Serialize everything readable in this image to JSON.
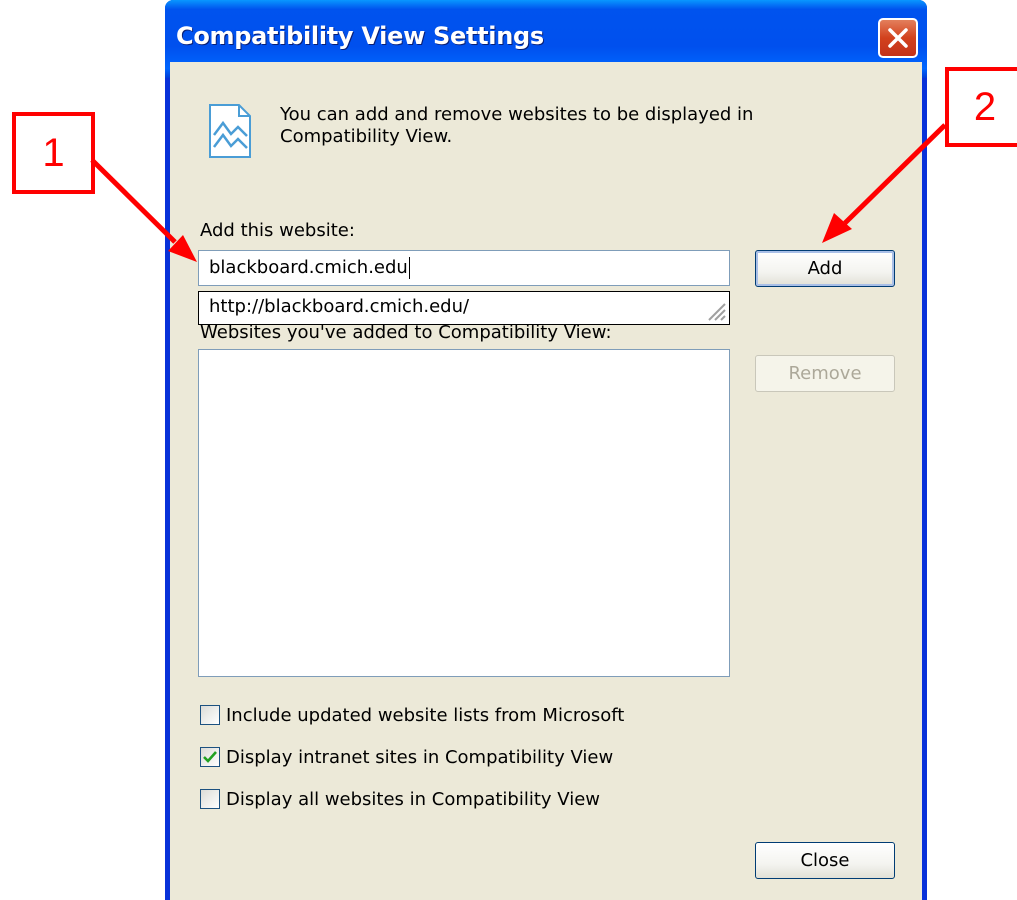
{
  "window": {
    "title": "Compatibility View Settings"
  },
  "info": {
    "text": "You can add and remove websites to be displayed in Compatibility View."
  },
  "add_site": {
    "label": "Add this website:",
    "value": "blackboard.cmich.edu",
    "suggestion": "http://blackboard.cmich.edu/"
  },
  "site_list": {
    "label": "Websites you've added to Compatibility View:",
    "items": []
  },
  "buttons": {
    "add": "Add",
    "remove": "Remove",
    "close": "Close"
  },
  "checkboxes": [
    {
      "label": "Include updated website lists from Microsoft",
      "checked": false
    },
    {
      "label": "Display intranet sites in Compatibility View",
      "checked": true
    },
    {
      "label": "Display all websites in Compatibility View",
      "checked": false
    }
  ],
  "callouts": {
    "one": "1",
    "two": "2"
  },
  "colors": {
    "callout": "#ff0000",
    "titlebar": "#0054e3",
    "dialog_bg": "#ece9d8"
  }
}
